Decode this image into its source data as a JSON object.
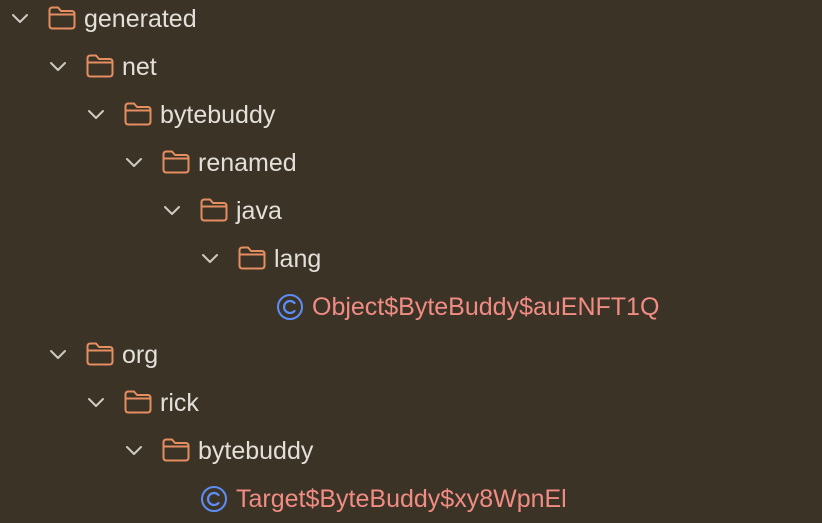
{
  "colors": {
    "background": "#3c3327",
    "folder_stroke": "#e58e62",
    "class_icon": "#5d8ef7",
    "class_text": "#f08c84",
    "folder_text": "#e3e0d9",
    "chevron": "#cfcbc2"
  },
  "tree": {
    "items": [
      {
        "label": "generated",
        "icon": "folder-icon",
        "expanded": true
      },
      {
        "label": "net",
        "icon": "folder-icon",
        "expanded": true
      },
      {
        "label": "bytebuddy",
        "icon": "folder-icon",
        "expanded": true
      },
      {
        "label": "renamed",
        "icon": "folder-icon",
        "expanded": true
      },
      {
        "label": "java",
        "icon": "folder-icon",
        "expanded": true
      },
      {
        "label": "lang",
        "icon": "folder-icon",
        "expanded": true
      },
      {
        "label": "Object$ByteBuddy$auENFT1Q",
        "icon": "class-icon"
      },
      {
        "label": "org",
        "icon": "folder-icon",
        "expanded": true
      },
      {
        "label": "rick",
        "icon": "folder-icon",
        "expanded": true
      },
      {
        "label": "bytebuddy",
        "icon": "folder-icon",
        "expanded": true
      },
      {
        "label": "Target$ByteBuddy$xy8WpnEl",
        "icon": "class-icon"
      }
    ]
  }
}
